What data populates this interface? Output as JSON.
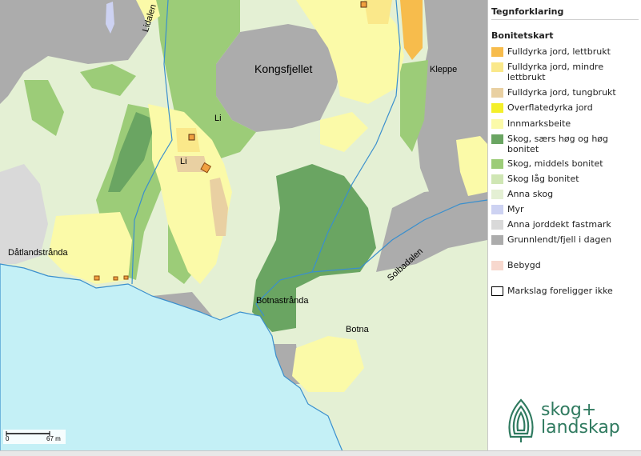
{
  "map": {
    "places": {
      "lidalen": "Lidalen",
      "kongsfjellet": "Kongsfjellet",
      "kleppe": "Kleppe",
      "li_upper": "Li",
      "li_lower": "Li",
      "datlandstranda": "Dåtlandstrånda",
      "solbadalen": "Solbadalen",
      "botnastranda": "Botnastrånda",
      "botna": "Botna"
    },
    "scalebar": {
      "start": "0",
      "end": "67 m"
    },
    "colors": {
      "sea": "#c4f0f6",
      "rock": "#acacac",
      "other_forest": "#e4f0d4",
      "forest_high": "#6aa562",
      "forest_medium": "#9ccc78",
      "pasture": "#fbfaa8",
      "river": "#3a8fcd"
    }
  },
  "legend": {
    "title": "Tegnforklaring",
    "subtitle": "Bonitetskart",
    "items": [
      {
        "label": "Fulldyrka jord, lettbrukt",
        "color": "#f7bc4c"
      },
      {
        "label": "Fulldyrka jord, mindre lettbrukt",
        "color": "#fae88a"
      },
      {
        "label": "Fulldyrka jord, tungbrukt",
        "color": "#e9d0a2"
      },
      {
        "label": "Overflatedyrka jord",
        "color": "#f4ef2a"
      },
      {
        "label": "Innmarksbeite",
        "color": "#fbfaa8"
      },
      {
        "label": "Skog, særs høg og høg bonitet",
        "color": "#6aa562"
      },
      {
        "label": "Skog, middels bonitet",
        "color": "#9ccc78"
      },
      {
        "label": "Skog låg bonitet",
        "color": "#cfe6b4"
      },
      {
        "label": "Anna skog",
        "color": "#e4f0d4"
      },
      {
        "label": "Myr",
        "color": "#cdd2f2"
      },
      {
        "label": "Anna jorddekt fastmark",
        "color": "#d9d9d9"
      },
      {
        "label": "Grunnlendt/fjell i dagen",
        "color": "#acacac"
      },
      {
        "label": "Bebygd",
        "color": "#f7d8ce"
      },
      {
        "label": "Markslag foreligger ikke",
        "color": "#ffffff"
      }
    ]
  },
  "logo": {
    "line1": "skog+",
    "line2": "landskap",
    "color": "#2f7a5f"
  }
}
